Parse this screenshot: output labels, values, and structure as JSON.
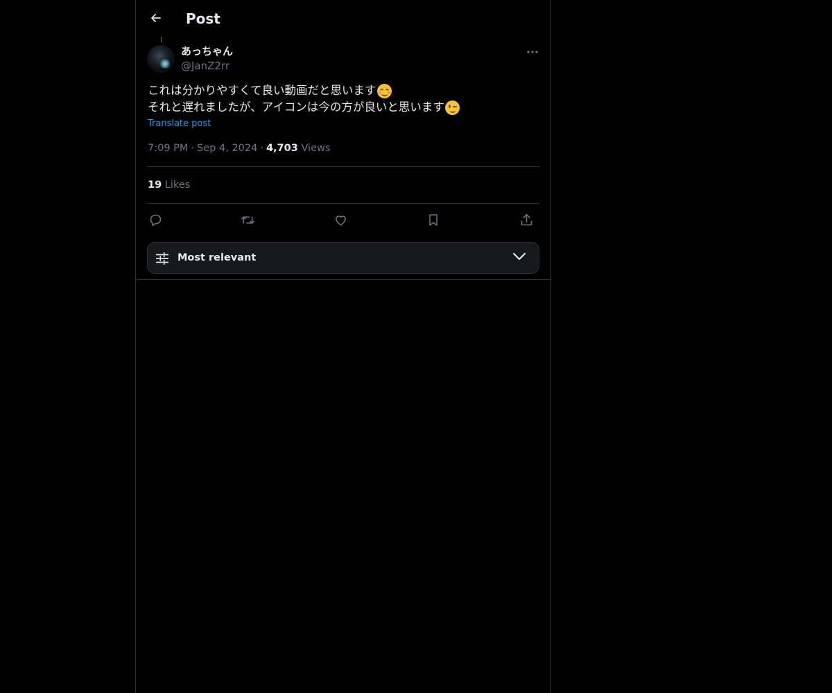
{
  "header": {
    "title": "Post",
    "back_icon": "arrow-left-icon"
  },
  "author": {
    "display_name": "あっちゃん",
    "handle": "@JanZ2rr",
    "more_icon": "more-horizontal-icon"
  },
  "post": {
    "lines": [
      {
        "text": "これは分かりやすくて良い動画だと思います",
        "emoji": "smiling-face-with-smiling-eyes-emoji"
      },
      {
        "text": "それと遅れましたが、アイコンは今の方が良いと思います",
        "emoji": "winking-face-emoji"
      }
    ],
    "translate_label": "Translate post"
  },
  "meta": {
    "time": "7:09 PM",
    "separator": "·",
    "date": "Sep 4, 2024",
    "views_count": "4,703",
    "views_label": "Views"
  },
  "stats": {
    "likes_count": "19",
    "likes_label": "Likes"
  },
  "actions": [
    {
      "name": "reply",
      "icon": "reply-icon"
    },
    {
      "name": "repost",
      "icon": "repost-icon"
    },
    {
      "name": "like",
      "icon": "heart-icon"
    },
    {
      "name": "bookmark",
      "icon": "bookmark-icon"
    },
    {
      "name": "share",
      "icon": "share-icon"
    }
  ],
  "replies_sort": {
    "label": "Most relevant",
    "icon": "sliders-icon",
    "chevron": "chevron-down-icon"
  },
  "colors": {
    "background": "#000000",
    "text": "#e7e9ea",
    "muted": "#71767b",
    "link": "#1d9bf0",
    "border": "#2f3336"
  }
}
